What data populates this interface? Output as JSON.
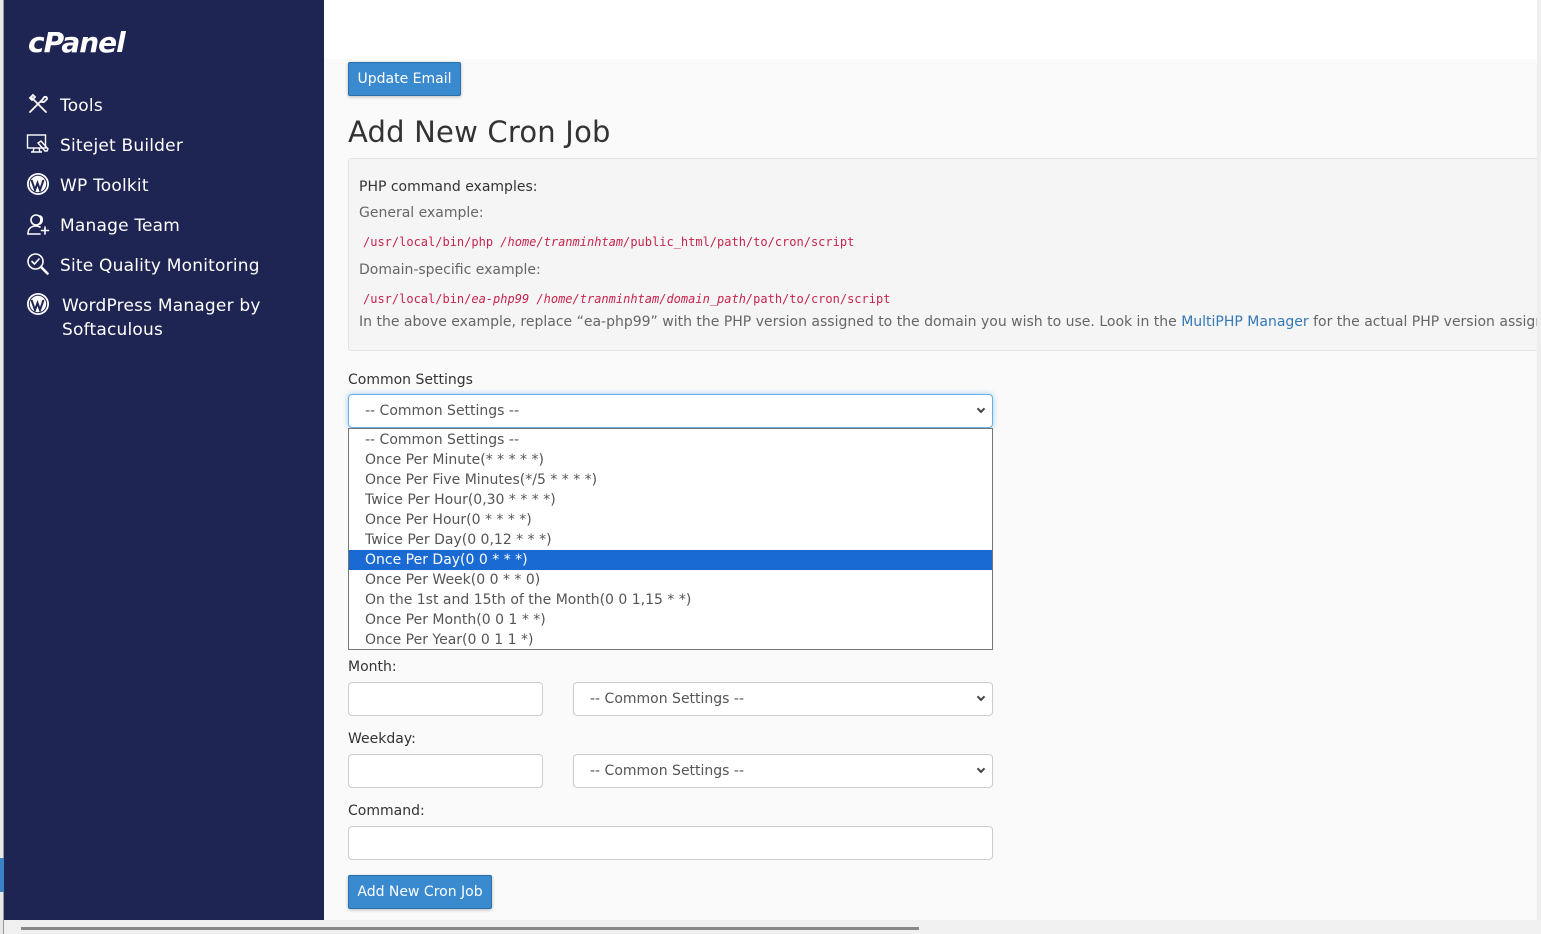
{
  "brand": {
    "logo_text": "cPanel",
    "sidebar_color": "#1f2552",
    "accent": "#3a8ad0"
  },
  "sidebar": {
    "items": [
      {
        "label": "Tools",
        "icon": "tools-icon"
      },
      {
        "label": "Sitejet Builder",
        "icon": "monitor-pen-icon"
      },
      {
        "label": "WP Toolkit",
        "icon": "wordpress-icon"
      },
      {
        "label": "Manage Team",
        "icon": "add-user-icon"
      },
      {
        "label": "Site Quality Monitoring",
        "icon": "magnifier-check-icon"
      },
      {
        "label": "WordPress Manager by Softaculous",
        "icon": "wordpress-icon"
      }
    ]
  },
  "main": {
    "update_email_label": "Update Email",
    "title": "Add New Cron Job",
    "examples": {
      "heading": "PHP command examples:",
      "general_label": "General example:",
      "general_code": {
        "part1": "/usr/local/bin/php ",
        "part2_italic": "/home/tranminhtam/",
        "part3": "public_html/path/to/cron/script"
      },
      "domain_label": "Domain-specific example:",
      "domain_code": {
        "part1": "/usr/local/bin/",
        "part2_italic": "ea-php99",
        "part3": " ",
        "part4_italic": "/home/tranminhtam/domain_path/",
        "part5": "path/to/cron/script"
      },
      "note_before": "In the above example, replace “ea-php99” with the PHP version assigned to the domain you wish to use. Look in the ",
      "note_link": "MultiPHP Manager",
      "note_after": " for the actual PHP version assigned to a domain."
    },
    "common_settings": {
      "label": "Common Settings",
      "selected": "-- Common Settings --",
      "options": [
        "-- Common Settings --",
        "Once Per Minute(* * * * *)",
        "Once Per Five Minutes(*/5 * * * *)",
        "Twice Per Hour(0,30 * * * *)",
        "Once Per Hour(0 * * * *)",
        "Twice Per Day(0 0,12 * * *)",
        "Once Per Day(0 0 * * *)",
        "Once Per Week(0 0 * * 0)",
        "On the 1st and 15th of the Month(0 0 1,15 * *)",
        "Once Per Month(0 0 1 * *)",
        "Once Per Year(0 0 1 1 *)"
      ],
      "highlighted_index": 6
    },
    "month": {
      "label": "Month:",
      "value": "",
      "select_value": "-- Common Settings --"
    },
    "weekday": {
      "label": "Weekday:",
      "value": "",
      "select_value": "-- Common Settings --"
    },
    "command": {
      "label": "Command:",
      "value": ""
    },
    "add_button_label": "Add New Cron Job"
  }
}
